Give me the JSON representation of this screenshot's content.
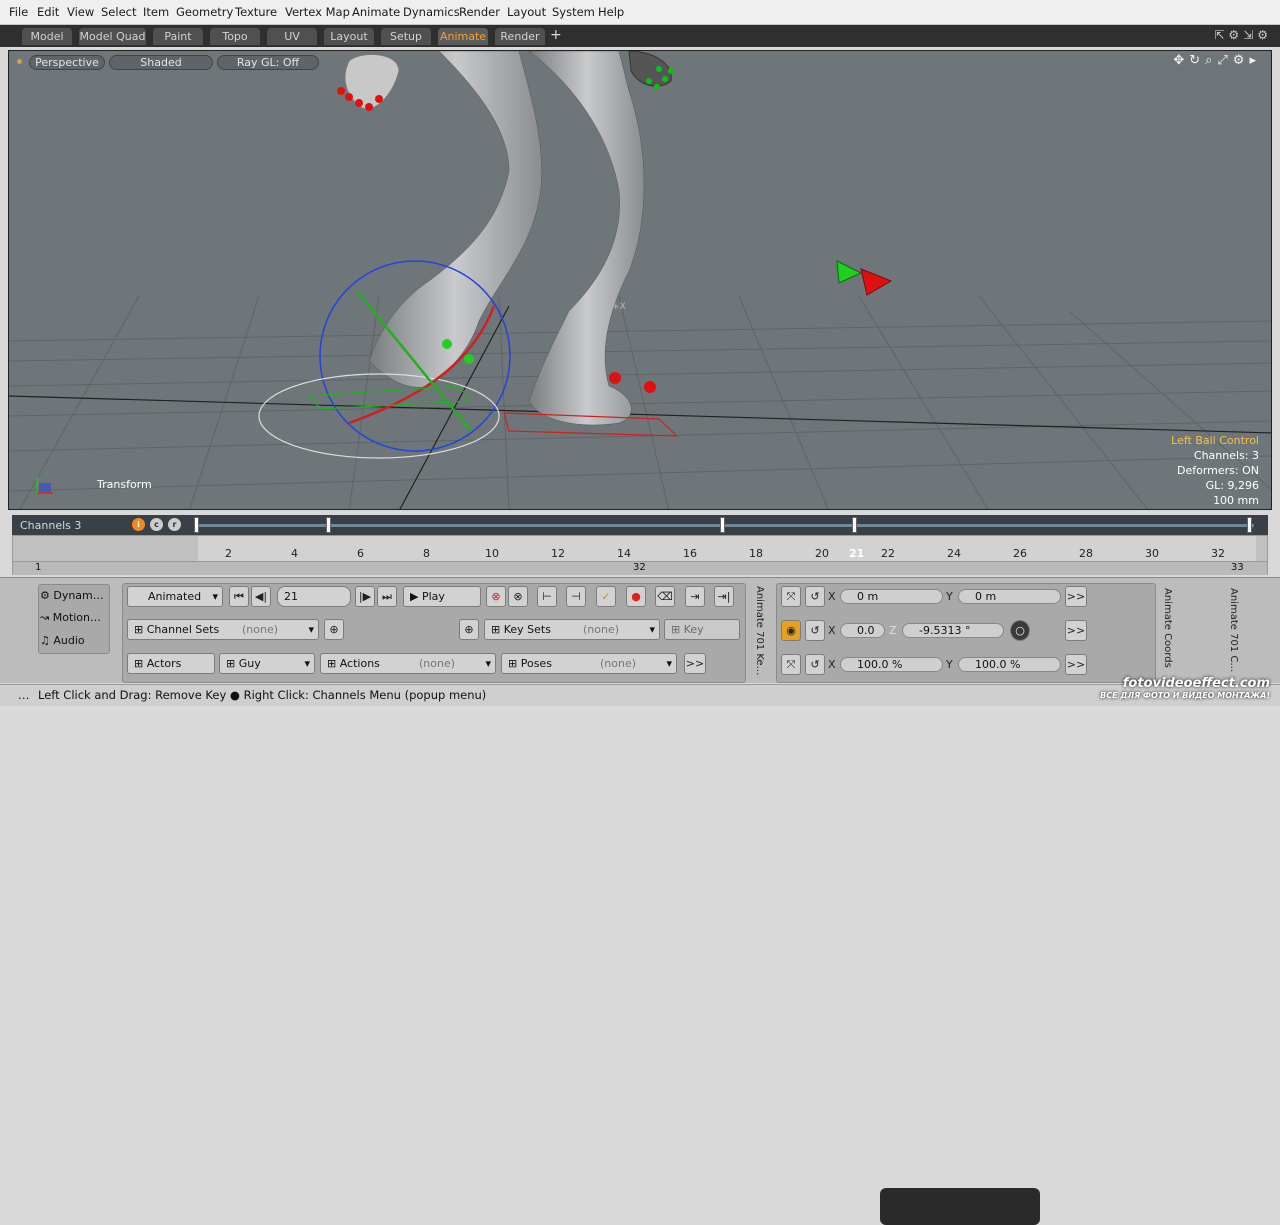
{
  "menubar": {
    "items": [
      "File",
      "Edit",
      "View",
      "Select",
      "Item",
      "Geometry",
      "Texture",
      "Vertex Map",
      "Animate",
      "Dynamics",
      "Render",
      "Layout",
      "System",
      "Help"
    ]
  },
  "tabs": {
    "items": [
      "Model",
      "Model Quad",
      "Paint",
      "Topo",
      "UV",
      "Layout",
      "Setup",
      "Animate",
      "Render"
    ],
    "active": "Animate",
    "add": "+"
  },
  "viewport": {
    "view_mode": "Perspective",
    "shading": "Shaded",
    "raygl": "Ray GL: Off",
    "mode_label": "Transform",
    "info": {
      "title": "Left Ball Control",
      "channels": "Channels: 3",
      "deformers": "Deformers: ON",
      "gl": "GL: 9,296",
      "scale": "100 mm"
    }
  },
  "timeline": {
    "label": "Channels 3",
    "icons": [
      "i",
      "c",
      "r"
    ],
    "ruler_ticks": [
      "2",
      "4",
      "6",
      "8",
      "10",
      "12",
      "14",
      "16",
      "18",
      "20",
      "21",
      "22",
      "24",
      "26",
      "28",
      "30",
      "32"
    ],
    "current_frame": "21",
    "start": "1",
    "mid": "32",
    "end": "33"
  },
  "panel": {
    "side": [
      "Dynam…",
      "Motion…",
      "Audio"
    ],
    "mode": "Animated",
    "frame_value": "21",
    "play_label": "Play",
    "channel_sets_label": "Channel Sets",
    "channel_sets_value": "(none)",
    "key_sets_label": "Key Sets",
    "key_sets_value": "(none)",
    "key_label": "Key",
    "actors_label": "Actors",
    "actor_value": "Guy",
    "actions_label": "Actions",
    "actions_value": "(none)",
    "poses_label": "Poses",
    "poses_value": "(none)",
    "more": ">>",
    "vtab1": "Animate 701 Ke…",
    "vtab2": "Animate Coords",
    "vtab3": "Animate 701 C…",
    "pos_x": "0 m",
    "pos_y": "0 m",
    "rot_x": "0.0",
    "rot_z": "-9.5313 °",
    "scale_x": "100.0 %",
    "scale_y": "100.0 %",
    "axis_x": "X",
    "axis_y": "Y",
    "axis_z": "Z"
  },
  "statusbar": {
    "text": "Left Click and Drag: Remove Key ● Right Click: Channels Menu (popup menu)",
    "dots": "…"
  },
  "watermark": {
    "line1": "fotovideoeffect.com",
    "line2": "ВСЕ ДЛЯ ФОТО И ВИДЕО МОНТАЖА!"
  }
}
